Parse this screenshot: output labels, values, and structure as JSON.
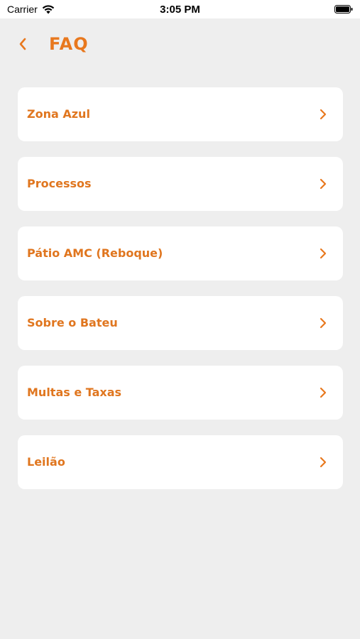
{
  "status_bar": {
    "carrier": "Carrier",
    "time": "3:05 PM"
  },
  "header": {
    "title": "FAQ",
    "back_icon": "chevron-left-icon"
  },
  "faq_items": [
    {
      "label": "Zona Azul"
    },
    {
      "label": "Processos"
    },
    {
      "label": "Pátio AMC (Reboque)"
    },
    {
      "label": "Sobre o Bateu"
    },
    {
      "label": "Multas e Taxas"
    },
    {
      "label": "Leilão"
    }
  ],
  "colors": {
    "accent": "#e8781e",
    "background": "#eeeeee",
    "card": "#ffffff"
  }
}
